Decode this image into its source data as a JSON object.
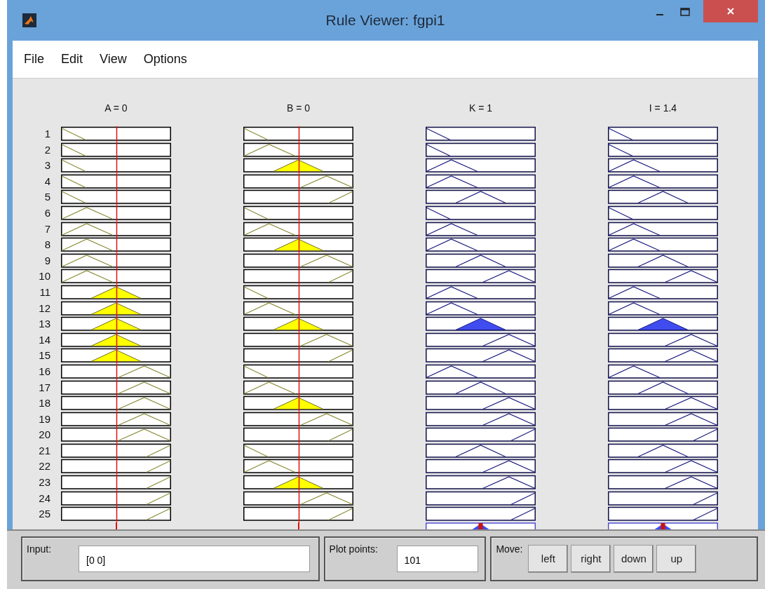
{
  "window": {
    "title": "Rule Viewer: fgpi1"
  },
  "menu": [
    "File",
    "Edit",
    "View",
    "Options"
  ],
  "variables": [
    {
      "label": "A = 0",
      "kind": "input"
    },
    {
      "label": "B = 0",
      "kind": "input"
    },
    {
      "label": "K = 1",
      "kind": "output"
    },
    {
      "label": "I = 1.4",
      "kind": "output"
    }
  ],
  "rules": [
    {
      "number": "1",
      "cells": [
        {
          "kind": "falling",
          "filled": false
        },
        {
          "kind": "falling",
          "filled": false
        },
        {
          "kind": "falling",
          "filled": false
        },
        {
          "kind": "falling",
          "filled": false
        }
      ]
    },
    {
      "number": "2",
      "cells": [
        {
          "kind": "falling",
          "filled": false
        },
        {
          "kind": "low",
          "filled": false
        },
        {
          "kind": "falling",
          "filled": false
        },
        {
          "kind": "falling",
          "filled": false
        }
      ]
    },
    {
      "number": "3",
      "cells": [
        {
          "kind": "falling",
          "filled": false
        },
        {
          "kind": "mid",
          "filled": true
        },
        {
          "kind": "low",
          "filled": false
        },
        {
          "kind": "low",
          "filled": false
        }
      ]
    },
    {
      "number": "4",
      "cells": [
        {
          "kind": "falling",
          "filled": false
        },
        {
          "kind": "high",
          "filled": false
        },
        {
          "kind": "low",
          "filled": false
        },
        {
          "kind": "low",
          "filled": false
        }
      ]
    },
    {
      "number": "5",
      "cells": [
        {
          "kind": "falling",
          "filled": false
        },
        {
          "kind": "rising",
          "filled": false
        },
        {
          "kind": "mid",
          "filled": false
        },
        {
          "kind": "mid",
          "filled": false
        }
      ]
    },
    {
      "number": "6",
      "cells": [
        {
          "kind": "low",
          "filled": false
        },
        {
          "kind": "falling",
          "filled": false
        },
        {
          "kind": "falling",
          "filled": false
        },
        {
          "kind": "falling",
          "filled": false
        }
      ]
    },
    {
      "number": "7",
      "cells": [
        {
          "kind": "low",
          "filled": false
        },
        {
          "kind": "low",
          "filled": false
        },
        {
          "kind": "low",
          "filled": false
        },
        {
          "kind": "low",
          "filled": false
        }
      ]
    },
    {
      "number": "8",
      "cells": [
        {
          "kind": "low",
          "filled": false
        },
        {
          "kind": "mid",
          "filled": true
        },
        {
          "kind": "low",
          "filled": false
        },
        {
          "kind": "low",
          "filled": false
        }
      ]
    },
    {
      "number": "9",
      "cells": [
        {
          "kind": "low",
          "filled": false
        },
        {
          "kind": "high",
          "filled": false
        },
        {
          "kind": "mid",
          "filled": false
        },
        {
          "kind": "mid",
          "filled": false
        }
      ]
    },
    {
      "number": "10",
      "cells": [
        {
          "kind": "low",
          "filled": false
        },
        {
          "kind": "rising",
          "filled": false
        },
        {
          "kind": "high",
          "filled": false
        },
        {
          "kind": "high",
          "filled": false
        }
      ]
    },
    {
      "number": "11",
      "cells": [
        {
          "kind": "mid",
          "filled": true
        },
        {
          "kind": "falling",
          "filled": false
        },
        {
          "kind": "low",
          "filled": false
        },
        {
          "kind": "low",
          "filled": false
        }
      ]
    },
    {
      "number": "12",
      "cells": [
        {
          "kind": "mid",
          "filled": true
        },
        {
          "kind": "low",
          "filled": false
        },
        {
          "kind": "low",
          "filled": false
        },
        {
          "kind": "low",
          "filled": false
        }
      ]
    },
    {
      "number": "13",
      "cells": [
        {
          "kind": "mid",
          "filled": true
        },
        {
          "kind": "mid",
          "filled": true
        },
        {
          "kind": "mid",
          "filled": true
        },
        {
          "kind": "mid",
          "filled": true
        }
      ]
    },
    {
      "number": "14",
      "cells": [
        {
          "kind": "mid",
          "filled": true
        },
        {
          "kind": "high",
          "filled": false
        },
        {
          "kind": "high",
          "filled": false
        },
        {
          "kind": "high",
          "filled": false
        }
      ]
    },
    {
      "number": "15",
      "cells": [
        {
          "kind": "mid",
          "filled": true
        },
        {
          "kind": "rising",
          "filled": false
        },
        {
          "kind": "high",
          "filled": false
        },
        {
          "kind": "high",
          "filled": false
        }
      ]
    },
    {
      "number": "16",
      "cells": [
        {
          "kind": "high",
          "filled": false
        },
        {
          "kind": "falling",
          "filled": false
        },
        {
          "kind": "low",
          "filled": false
        },
        {
          "kind": "low",
          "filled": false
        }
      ]
    },
    {
      "number": "17",
      "cells": [
        {
          "kind": "high",
          "filled": false
        },
        {
          "kind": "low",
          "filled": false
        },
        {
          "kind": "mid",
          "filled": false
        },
        {
          "kind": "mid",
          "filled": false
        }
      ]
    },
    {
      "number": "18",
      "cells": [
        {
          "kind": "high",
          "filled": false
        },
        {
          "kind": "mid",
          "filled": true
        },
        {
          "kind": "high",
          "filled": false
        },
        {
          "kind": "high",
          "filled": false
        }
      ]
    },
    {
      "number": "19",
      "cells": [
        {
          "kind": "high",
          "filled": false
        },
        {
          "kind": "high",
          "filled": false
        },
        {
          "kind": "high",
          "filled": false
        },
        {
          "kind": "high",
          "filled": false
        }
      ]
    },
    {
      "number": "20",
      "cells": [
        {
          "kind": "high",
          "filled": false
        },
        {
          "kind": "rising",
          "filled": false
        },
        {
          "kind": "rising",
          "filled": false
        },
        {
          "kind": "rising",
          "filled": false
        }
      ]
    },
    {
      "number": "21",
      "cells": [
        {
          "kind": "rising",
          "filled": false
        },
        {
          "kind": "falling",
          "filled": false
        },
        {
          "kind": "mid",
          "filled": false
        },
        {
          "kind": "mid",
          "filled": false
        }
      ]
    },
    {
      "number": "22",
      "cells": [
        {
          "kind": "rising",
          "filled": false
        },
        {
          "kind": "low",
          "filled": false
        },
        {
          "kind": "high",
          "filled": false
        },
        {
          "kind": "high",
          "filled": false
        }
      ]
    },
    {
      "number": "23",
      "cells": [
        {
          "kind": "rising",
          "filled": false
        },
        {
          "kind": "mid",
          "filled": true
        },
        {
          "kind": "high",
          "filled": false
        },
        {
          "kind": "high",
          "filled": false
        }
      ]
    },
    {
      "number": "24",
      "cells": [
        {
          "kind": "rising",
          "filled": false
        },
        {
          "kind": "high",
          "filled": false
        },
        {
          "kind": "rising",
          "filled": false
        },
        {
          "kind": "rising",
          "filled": false
        }
      ]
    },
    {
      "number": "25",
      "cells": [
        {
          "kind": "rising",
          "filled": false
        },
        {
          "kind": "rising",
          "filled": false
        },
        {
          "kind": "rising",
          "filled": false
        },
        {
          "kind": "rising",
          "filled": false
        }
      ]
    }
  ],
  "input": {
    "label": "Input:",
    "value": "[0 0]"
  },
  "plot_points": {
    "label": "Plot points:",
    "value": "101"
  },
  "move": {
    "label": "Move:",
    "buttons": [
      "left",
      "right",
      "down",
      "up"
    ]
  }
}
